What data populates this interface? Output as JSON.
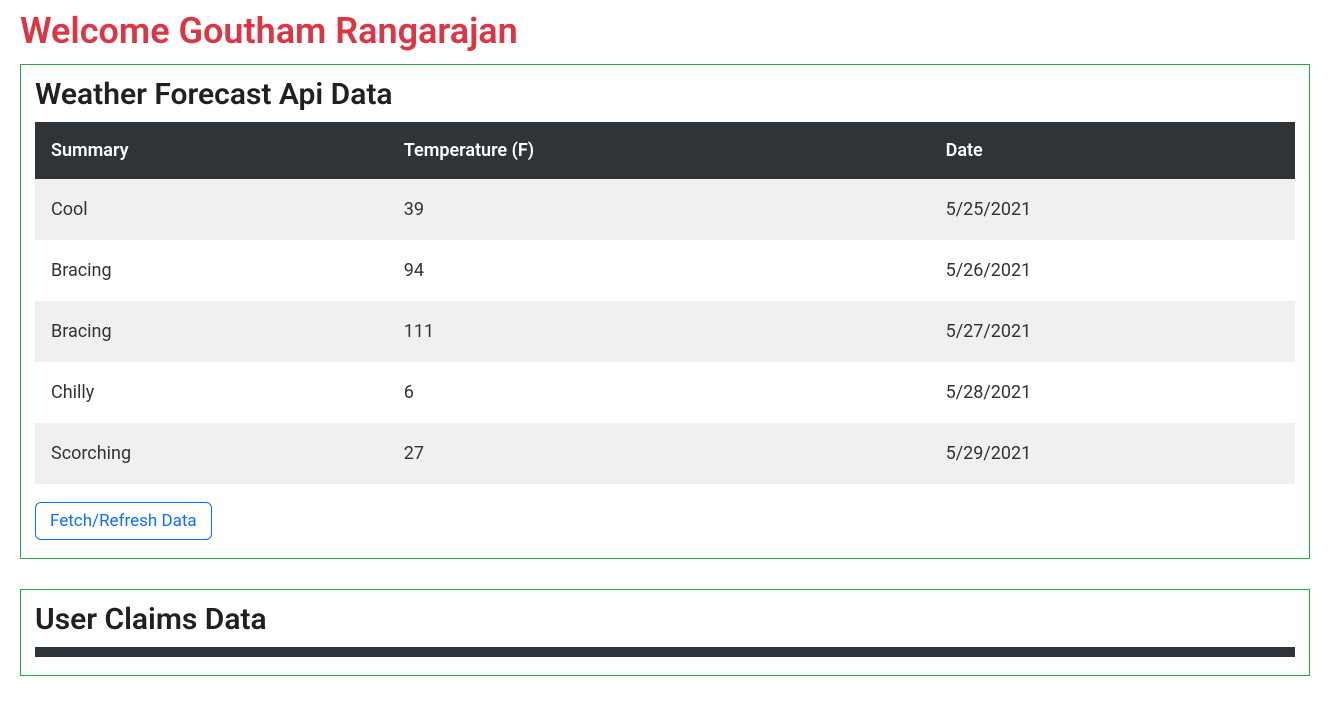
{
  "page": {
    "welcome": "Welcome Goutham Rangarajan"
  },
  "weather": {
    "title": "Weather Forecast Api Data",
    "columns": {
      "summary": "Summary",
      "temperature": "Temperature (F)",
      "date": "Date"
    },
    "rows": [
      {
        "summary": "Cool",
        "temperature": "39",
        "date": "5/25/2021"
      },
      {
        "summary": "Bracing",
        "temperature": "94",
        "date": "5/26/2021"
      },
      {
        "summary": "Bracing",
        "temperature": "111",
        "date": "5/27/2021"
      },
      {
        "summary": "Chilly",
        "temperature": "6",
        "date": "5/28/2021"
      },
      {
        "summary": "Scorching",
        "temperature": "27",
        "date": "5/29/2021"
      }
    ],
    "button_label": "Fetch/Refresh Data"
  },
  "claims": {
    "title": "User Claims Data"
  }
}
